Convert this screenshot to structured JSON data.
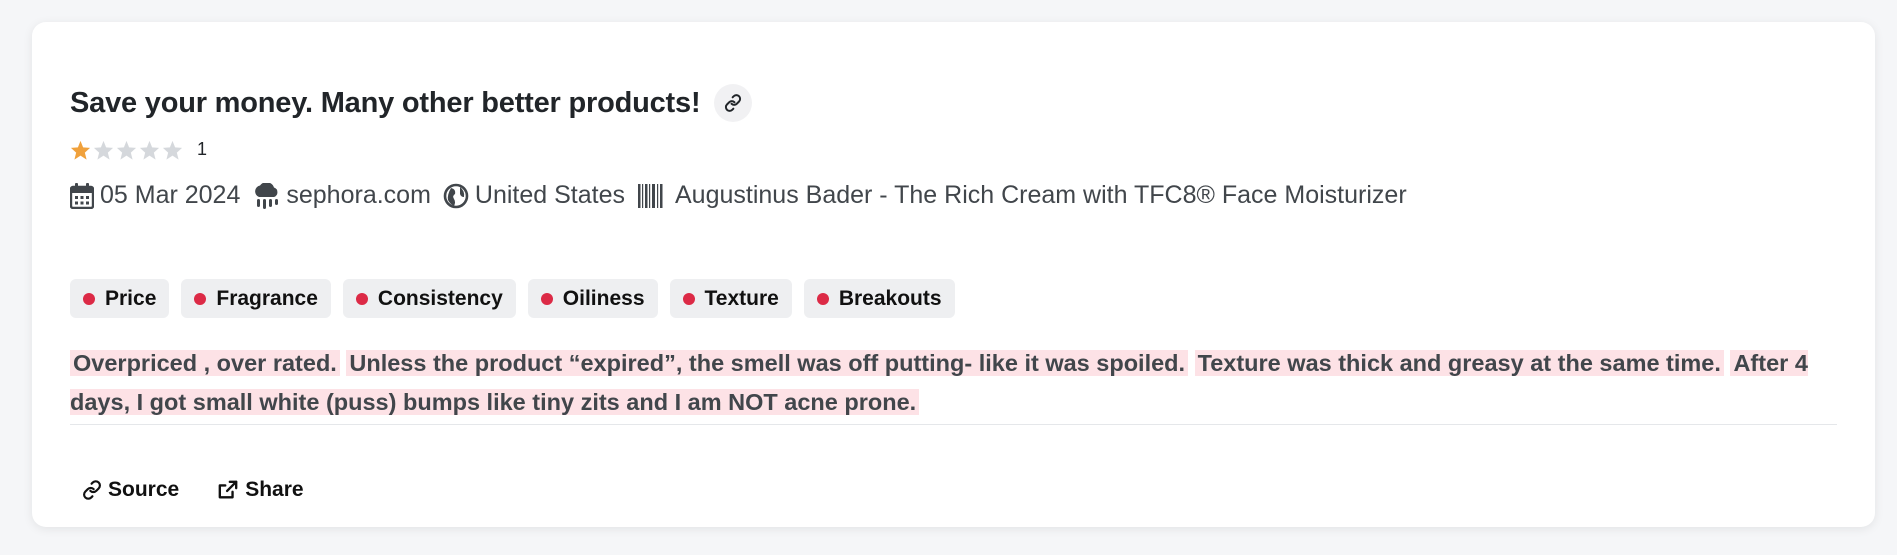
{
  "review": {
    "title": "Save your money. Many other better products!",
    "rating": 1,
    "rating_max": 5,
    "rating_label": "1",
    "date": "05 Mar 2024",
    "source": "sephora.com",
    "country": "United States",
    "product": "Augustinus Bader - The Rich Cream with TFC8® Face Moisturizer",
    "tags": [
      {
        "label": "Price",
        "color": "#dc2a46"
      },
      {
        "label": "Fragrance",
        "color": "#dc2a46"
      },
      {
        "label": "Consistency",
        "color": "#dc2a46"
      },
      {
        "label": "Oiliness",
        "color": "#dc2a46"
      },
      {
        "label": "Texture",
        "color": "#dc2a46"
      },
      {
        "label": "Breakouts",
        "color": "#dc2a46"
      }
    ],
    "sentences": [
      "Overpriced , over rated.",
      "Unless the product “expired”, the smell was off putting- like it was spoiled.",
      "Texture was thick and greasy at the same time.",
      "After 4 days, I got small white (puss) bumps like tiny zits and I am NOT acne prone."
    ]
  },
  "actions": {
    "source_label": "Source",
    "share_label": "Share"
  },
  "colors": {
    "star_filled": "#f0a13c",
    "star_empty": "#d5d8dc",
    "highlight": "#fde2e6",
    "tag_dot": "#dc2a46"
  }
}
